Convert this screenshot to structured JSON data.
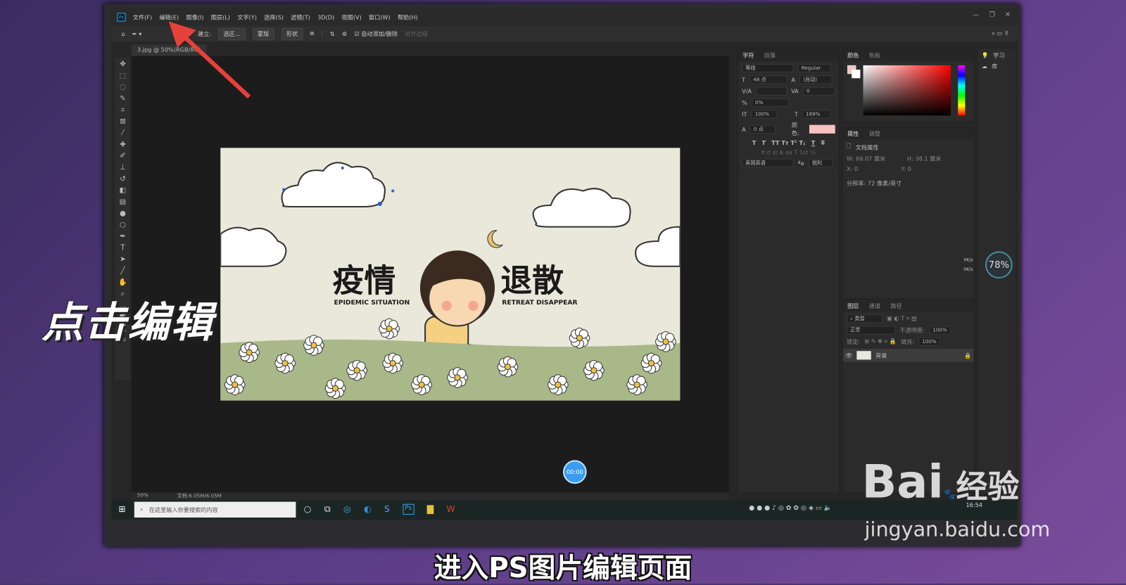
{
  "menubar": {
    "app_icon": "Ps",
    "items": [
      "文件(F)",
      "编辑(E)",
      "图像(I)",
      "图层(L)",
      "文字(Y)",
      "选择(S)",
      "滤镜(T)",
      "3D(D)",
      "视图(V)",
      "窗口(W)",
      "帮助(H)"
    ]
  },
  "options": {
    "build_label": "建立:",
    "selection": "选区...",
    "mask": "蒙版",
    "shape": "形状",
    "auto_add": "自动添加/删除",
    "align_edges": "对齐边缘"
  },
  "document_tab": "3.jpg @ 50%(RGB/8#)",
  "artwork": {
    "title_left": "疫情",
    "title_right": "退散",
    "sub_left": "EPIDEMIC SITUATION",
    "sub_right": "RETREAT DISAPPEAR"
  },
  "status": {
    "zoom": "50%",
    "doc": "文档:6.05M/6.05M"
  },
  "character_panel": {
    "tabs": [
      "字符",
      "段落"
    ],
    "font": "等线",
    "style": "Regular",
    "size": "48 点",
    "leading": "(自动)",
    "tracking": "0",
    "scale_pct": "0%",
    "vscale": "100%",
    "hscale": "189%",
    "baseline": "0 点",
    "color_label": "颜色:",
    "language": "美国英语",
    "aa": "锐利",
    "swatch": "#f5c2c0"
  },
  "color_panel": {
    "tabs": [
      "颜色",
      "色板"
    ]
  },
  "properties_panel": {
    "tabs": [
      "属性",
      "调整"
    ],
    "title": "文档属性",
    "w": "W: 69.07 厘米",
    "h": "H: 38.1 厘米",
    "x": "X: 0",
    "y": "Y: 0",
    "resolution": "分辨率: 72 像素/英寸"
  },
  "side_column": {
    "learn": "学习",
    "library": "库"
  },
  "layers_panel": {
    "tabs": [
      "图层",
      "通道",
      "路径"
    ],
    "filter": "类型",
    "blend": "正常",
    "opacity_label": "不透明度:",
    "opacity": "100%",
    "lock_label": "锁定:",
    "fill_label": "填充:",
    "fill": "100%",
    "layer_name": "背景"
  },
  "taskbar": {
    "search_placeholder": "在这里输入你要搜索的内容",
    "time": "16:54"
  },
  "net_gauge": {
    "percent": "78%",
    "up": "0K/s",
    "down": "0K/s"
  },
  "timer": "00:00",
  "overlay_caption": "点击编辑",
  "subtitle": "进入PS图片编辑页面",
  "watermark": {
    "brand": "Bai",
    "brand2": "经验",
    "url": "jingyan.baidu.com"
  },
  "colors": {
    "arrow": "#e8403a",
    "accent": "#3a9cf0"
  }
}
